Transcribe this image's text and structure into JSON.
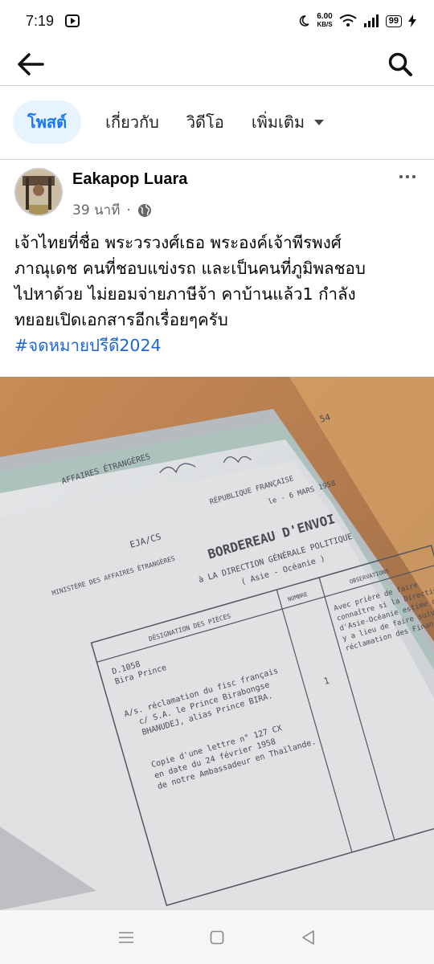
{
  "status_bar": {
    "time": "7:19",
    "network_speed_value": "6.00",
    "network_speed_unit": "KB/S",
    "battery_level": "99"
  },
  "header": {
    "back_icon": "arrow-left-icon",
    "search_icon": "search-icon"
  },
  "tabs": [
    {
      "label": "โพสต์",
      "active": true
    },
    {
      "label": "เกี่ยวกับ",
      "active": false
    },
    {
      "label": "วิดีโอ",
      "active": false
    },
    {
      "label": "เพิ่มเติม",
      "active": false
    }
  ],
  "post": {
    "author": "Eakapop Luara",
    "time_ago": "39 นาที",
    "separator": "·",
    "privacy_icon": "globe-icon",
    "text_lines": [
      "เจ้าไทยที่ชื่อ พระวรวงศ์เธอ พระองค์เจ้าพีรพงศ์",
      "ภาณุเดช คนที่ชอบแข่งรถ และเป็นคนที่ภูมิพลชอบ",
      "ไปหาด้วย ไม่ยอมจ่ายภาษีจ้า คาบ้านแล้ว1 กำลัง",
      "ทยอยเปิดเอกสารอีกเรื่อยๆครับ"
    ],
    "hashtag": "#จดหมายปรีดี2024",
    "photo": {
      "doc_header_left": "AFFAIRES ÉTRANGÈRES",
      "doc_ministere": "MINISTÈRE DES AFFAIRES ÉTRANGÈRES",
      "doc_ref": "EJA/CS",
      "doc_republique": "RÉPUBLIQUE FRANÇAISE",
      "doc_date": "le - 6 MARS 1958",
      "doc_title": "BORDEREAU D'ENVOI",
      "doc_subtitle": "à LA DIRECTION GÉNÉRALE POLITIQUE",
      "doc_region": "( Asie - Océanie )",
      "doc_col_designation": "DÉSIGNATION DES PIÈCES",
      "doc_col_nombre": "NOMBRE",
      "doc_col_observations": "OBSERVATIONS",
      "doc_ref2": "D.1058",
      "doc_ref3": "Bira Prince",
      "doc_line1": "A/s. réclamation du fisc français",
      "doc_line2": "c/ S.A. le Prince Birabongse",
      "doc_line3": "BHANUDEJ, alias Prince BIRA.",
      "doc_line4": "Copie d'une lettre n° 127 CX",
      "doc_line5": "en date du 24 février 1958",
      "doc_line6": "de notre Ambassadeur en Thaïlande.",
      "doc_obs1": "Avec prière de faire",
      "doc_obs2": "connaître si la Direction",
      "doc_obs3": "d'Asie-Océanie estime qu'il",
      "doc_obs4": "y a lieu de faire suivre la",
      "doc_obs5": "réclamation des Finances.",
      "doc_number": "1",
      "doc_page": "54"
    }
  },
  "nav": {
    "recents_icon": "menu-lines-icon",
    "home_icon": "square-icon",
    "back_icon": "triangle-back-icon"
  }
}
